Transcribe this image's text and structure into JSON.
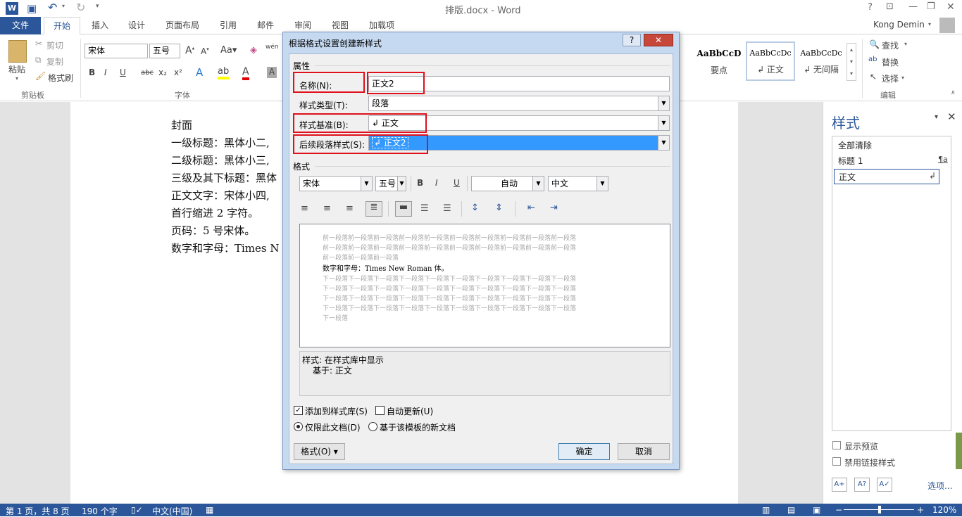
{
  "window": {
    "title": "排版.docx - Word",
    "user": "Kong Demin",
    "help": "?"
  },
  "tabs": [
    {
      "label": "文件"
    },
    {
      "label": "开始"
    },
    {
      "label": "插入"
    },
    {
      "label": "设计"
    },
    {
      "label": "页面布局"
    },
    {
      "label": "引用"
    },
    {
      "label": "邮件"
    },
    {
      "label": "审阅"
    },
    {
      "label": "视图"
    },
    {
      "label": "加载项"
    }
  ],
  "ribbon": {
    "clipboard": {
      "paste": "粘贴",
      "cut": "剪切",
      "copy": "复制",
      "format_painter": "格式刷",
      "group": "剪贴板"
    },
    "font": {
      "font_name": "宋体",
      "font_size": "五号",
      "group": "字体",
      "wen": "wén",
      "bold": "B",
      "italic": "I",
      "underline": "U",
      "strike": "abc",
      "sub": "x₂",
      "sup": "x²"
    },
    "styles": {
      "items": [
        {
          "preview": "AaBbCcD",
          "label": "要点"
        },
        {
          "preview": "AaBbCcDc",
          "label": "↲ 正文"
        },
        {
          "preview": "AaBbCcDc",
          "label": "↲ 无间隔"
        }
      ]
    },
    "editing": {
      "find": "查找",
      "replace": "替换",
      "select": "选择",
      "group": "编辑"
    }
  },
  "document": {
    "lines": [
      "封面",
      "一级标题：黑体小二,",
      "二级标题：黑体小三,",
      "三级及其下标题：黑体",
      "正文文字：宋体小四,",
      "首行缩进 2 字符。",
      "页码：5 号宋体。",
      "数字和字母：Times N"
    ]
  },
  "styles_pane": {
    "title": "样式",
    "items": [
      {
        "label": "全部清除",
        "mark": ""
      },
      {
        "label": "标题 1",
        "mark": "¶a"
      },
      {
        "label": "正文",
        "mark": "↲"
      }
    ],
    "show_preview": "显示预览",
    "disable_linked": "禁用链接样式",
    "options": "选项..."
  },
  "dialog": {
    "title": "根据格式设置创建新样式",
    "properties_label": "属性",
    "name_label": "名称(N):",
    "name_value": "正文2",
    "type_label": "样式类型(T):",
    "type_value": "段落",
    "based_label": "样式基准(B):",
    "based_value": "↲ 正文",
    "next_label": "后续段落样式(S):",
    "next_value": "↲ 正文2",
    "format_label": "格式",
    "font": "宋体",
    "size": "五号",
    "color": "自动",
    "script": "中文",
    "bold": "B",
    "italic": "I",
    "underline": "U",
    "preview_prev": [
      "前一段落前一段落前一段落前一段落前一段落前一段落前一段落前一段落前一段落前一段落",
      "前一段落前一段落前一段落前一段落前一段落前一段落前一段落前一段落前一段落前一段落",
      "前一段落前一段落前一段落"
    ],
    "preview_text": "数字和字母：Times New Roman 体。",
    "preview_next": [
      "下一段落下一段落下一段落下一段落下一段落下一段落下一段落下一段落下一段落下一段落",
      "下一段落下一段落下一段落下一段落下一段落下一段落下一段落下一段落下一段落下一段落",
      "下一段落下一段落下一段落下一段落下一段落下一段落下一段落下一段落下一段落下一段落",
      "下一段落下一段落下一段落下一段落下一段落下一段落下一段落下一段落下一段落下一段落",
      "下一段落"
    ],
    "desc_line1": "样式: 在样式库中显示",
    "desc_line2": "基于: 正文",
    "add_to_gallery": "添加到样式库(S)",
    "auto_update": "自动更新(U)",
    "only_this_doc": "仅限此文档(D)",
    "new_docs": "基于该模板的新文档",
    "format_button": "格式(O) ▾",
    "ok": "确定",
    "cancel": "取消"
  },
  "status": {
    "page": "第 1 页，共 8 页",
    "words": "190 个字",
    "lang": "中文(中国)",
    "zoom": "120%"
  },
  "colors": {
    "accent": "#2b579a",
    "highlight": "#3399ff",
    "redbox": "#e0101c"
  }
}
